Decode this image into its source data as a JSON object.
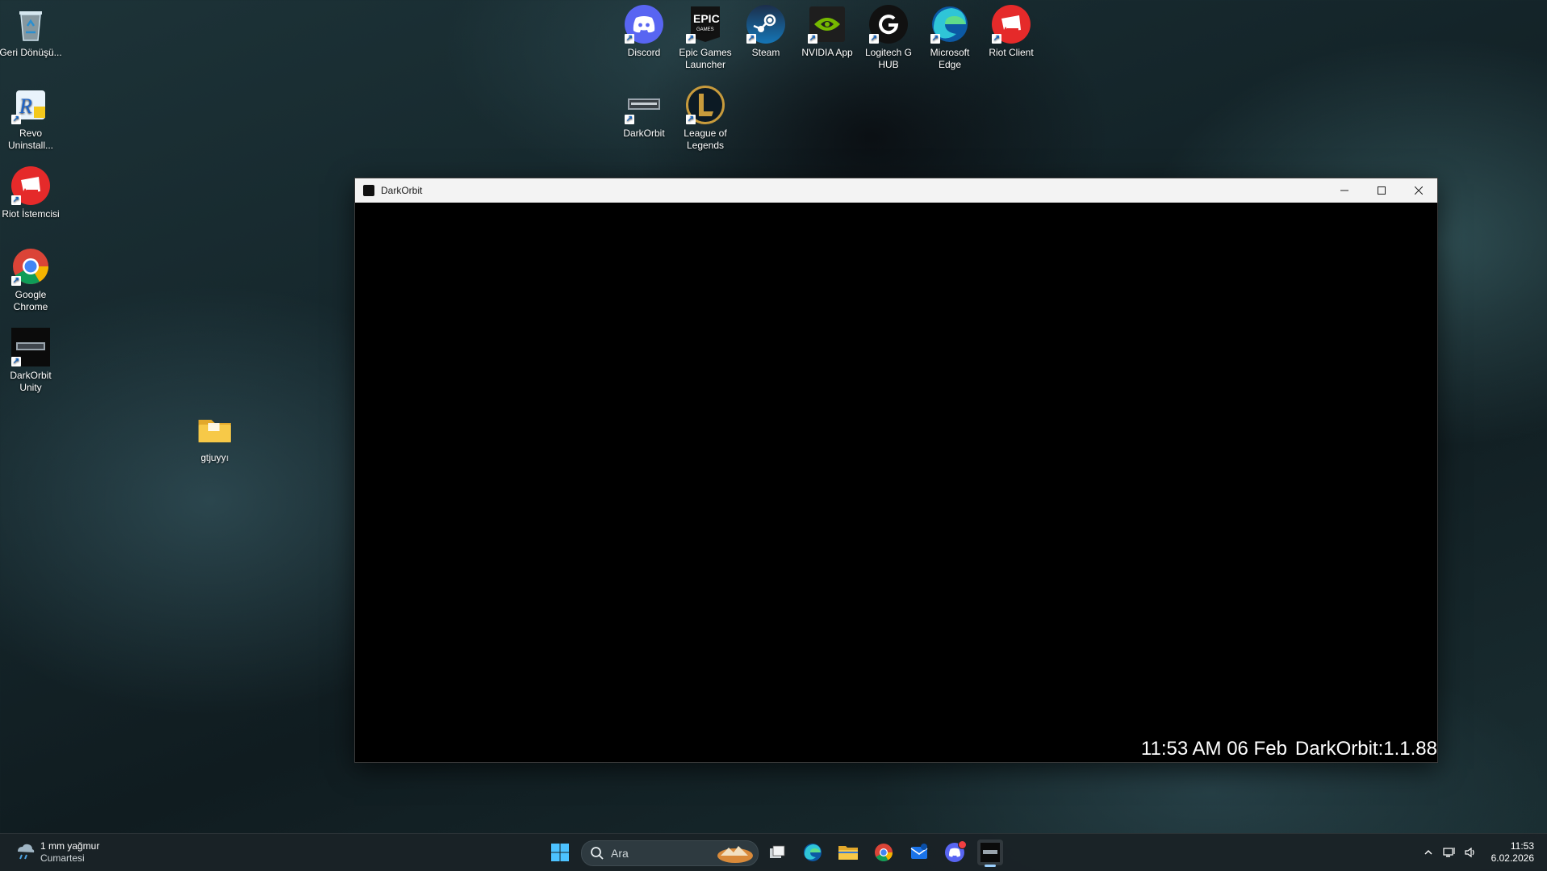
{
  "desktop_icons_left": [
    {
      "label": "Geri Dönüşü...",
      "icon": "recycle-bin-icon"
    },
    {
      "label": "Revo Uninstall...",
      "icon": "revo-uninstaller-icon"
    },
    {
      "label": "Riot İstemcisi",
      "icon": "riot-client-icon"
    },
    {
      "label": "Google Chrome",
      "icon": "chrome-icon"
    },
    {
      "label": "DarkOrbit Unity",
      "icon": "darkorbit-icon"
    }
  ],
  "folder": {
    "label": "gtjuyyı"
  },
  "desktop_icons_top": [
    {
      "label": "Discord",
      "icon": "discord-icon"
    },
    {
      "label": "Epic Games Launcher",
      "icon": "epic-games-icon"
    },
    {
      "label": "Steam",
      "icon": "steam-icon"
    },
    {
      "label": "NVIDIA App",
      "icon": "nvidia-icon"
    },
    {
      "label": "Logitech G HUB",
      "icon": "logitech-icon"
    },
    {
      "label": "Microsoft Edge",
      "icon": "edge-icon"
    },
    {
      "label": "Riot Client",
      "icon": "riot-client-icon"
    }
  ],
  "desktop_icons_row2": [
    {
      "label": "DarkOrbit",
      "icon": "darkorbit-icon"
    },
    {
      "label": "League of Legends",
      "icon": "league-icon"
    }
  ],
  "window": {
    "title": "DarkOrbit",
    "overlay_time": "11:53 AM 06 Feb",
    "overlay_version": "DarkOrbit:1.1.88"
  },
  "taskbar": {
    "weather_temp": "1 mm yağmur",
    "weather_day": "Cumartesi",
    "search_placeholder": "Ara",
    "time": "11:53",
    "date": "6.02.2026"
  },
  "colors": {
    "discord": "#5865f2",
    "riot": "#e52a2a",
    "nvidia": "#76b900",
    "folder": "#f7c948"
  }
}
